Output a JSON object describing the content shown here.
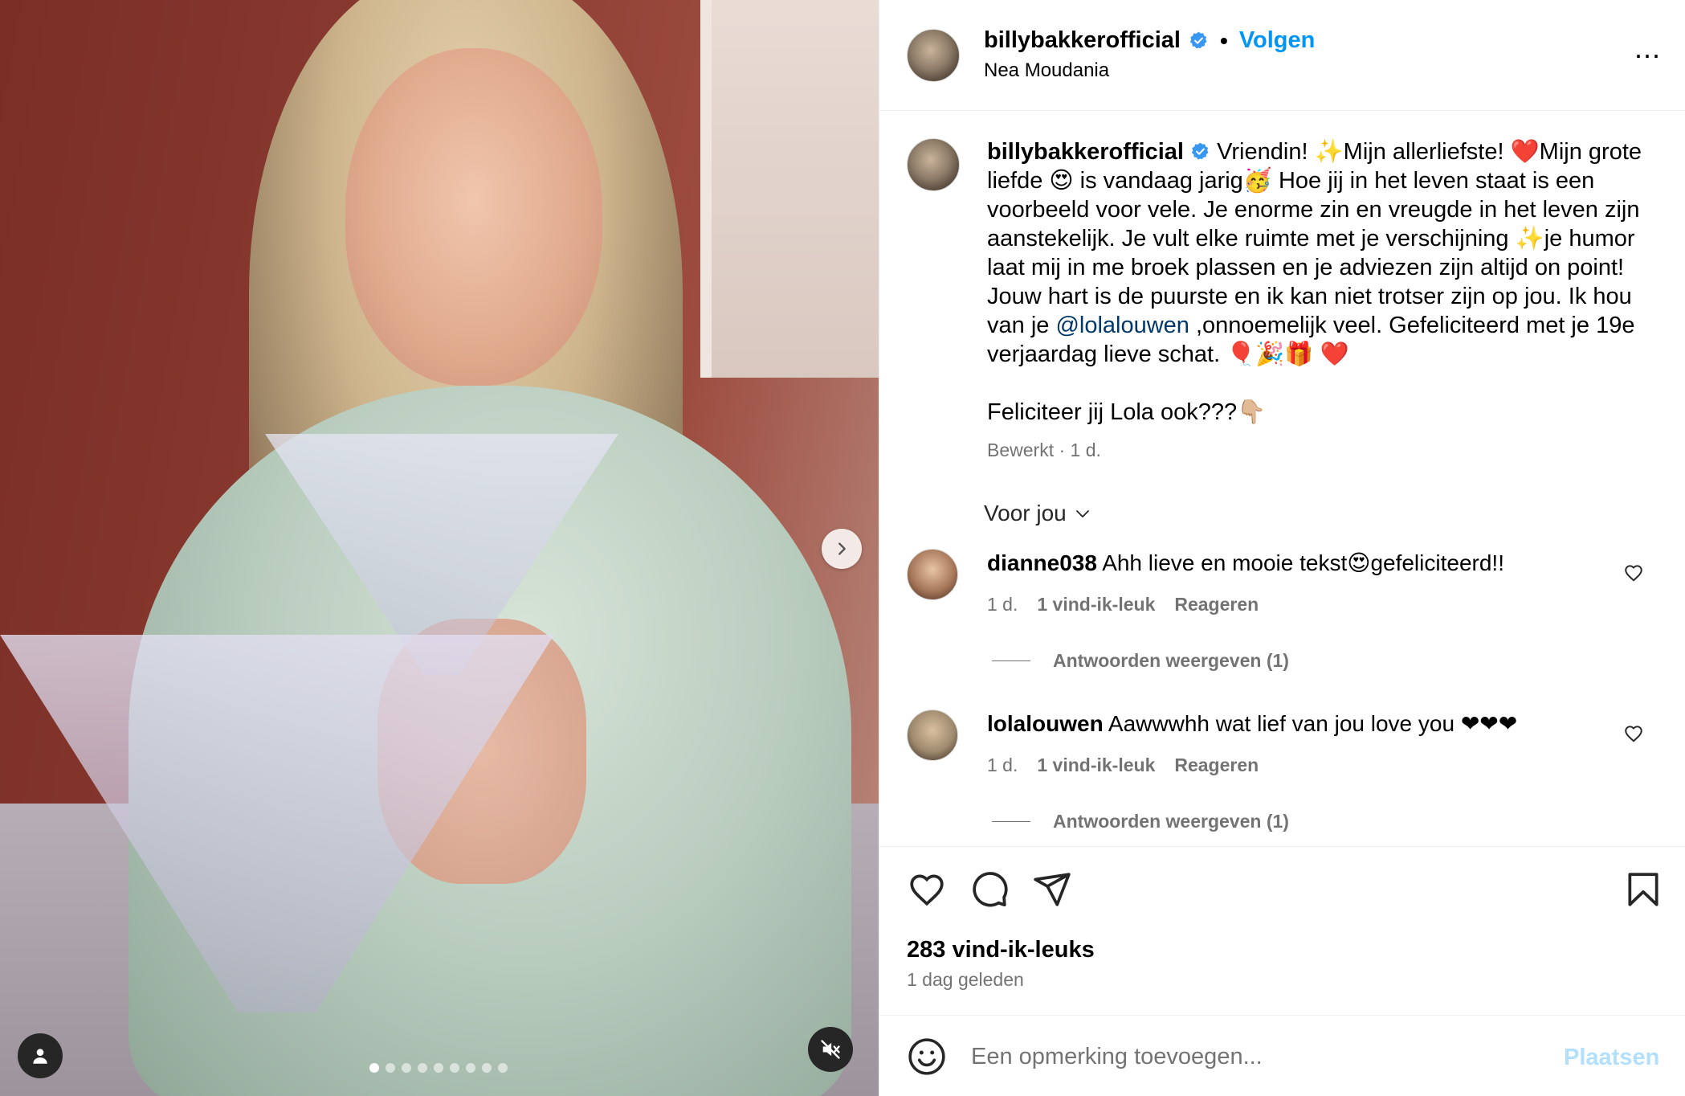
{
  "post": {
    "username": "billybakkerofficial",
    "follow_label": "Volgen",
    "separator": "•",
    "location": "Nea Moudania",
    "more_label": "..."
  },
  "caption": {
    "username": "billybakkerofficial",
    "text_part1": "Vriendin! ✨Mijn allerliefste! ❤️Mijn grote liefde 😍 is vandaag jarig🥳 Hoe jij in het leven staat is een voorbeeld voor vele. Je enorme zin en vreugde in het leven zijn aanstekelijk. Je vult elke ruimte met je verschijning ✨je humor laat mij in me broek plassen en je adviezen zijn altijd on point! Jouw hart is de puurste en ik kan niet trotser zijn op jou. Ik hou van je ",
    "mention": "@lolalouwen",
    "text_part2": " ,onnoemelijk veel. Gefeliciteerd met je 19e verjaardag lieve schat. 🎈🎉🎁 ❤️",
    "text_paragraph2": "Feliciteer jij Lola ook???👇🏼",
    "meta": "Bewerkt · 1 d."
  },
  "for_you_label": "Voor jou",
  "comments": [
    {
      "username": "dianne038",
      "text": "Ahh lieve en mooie tekst😍gefeliciteerd!!",
      "time": "1 d.",
      "likes": "1 vind-ik-leuk",
      "reply_label": "Reageren",
      "view_replies": "Antwoorden weergeven (1)"
    },
    {
      "username": "lolalouwen",
      "text": "Aawwwhh wat lief van jou love you ❤❤❤",
      "time": "1 d.",
      "likes": "1 vind-ik-leuk",
      "reply_label": "Reageren",
      "view_replies": "Antwoorden weergeven (1)"
    }
  ],
  "stats": {
    "likes": "283 vind-ik-leuks",
    "time_ago": "1 dag geleden"
  },
  "add_comment": {
    "placeholder": "Een opmerking toevoegen...",
    "post_label": "Plaatsen"
  },
  "carousel": {
    "total_slides": 9,
    "current_slide": 1
  },
  "colors": {
    "accent": "#0095f6",
    "verified": "#3897f0",
    "muted_text": "#737373",
    "mention": "#00376b",
    "post_disabled": "#b2dffc"
  },
  "icons": [
    "verified-badge-icon",
    "more-options-icon",
    "chevron-down-icon",
    "heart-icon",
    "comment-icon",
    "share-icon",
    "bookmark-icon",
    "emoji-icon",
    "chevron-right-icon",
    "user-tag-icon",
    "muted-speaker-icon"
  ]
}
